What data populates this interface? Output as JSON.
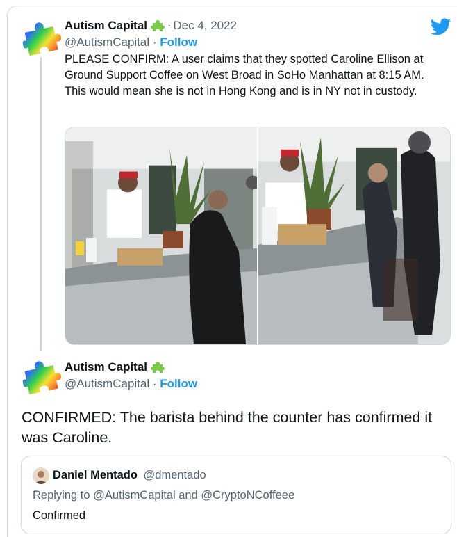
{
  "tweet1": {
    "author_name": "Autism Capital",
    "handle": "@AutismCapital",
    "separator": "·",
    "follow_label": "Follow",
    "date": "Dec 4, 2022",
    "text": "PLEASE CONFIRM: A user claims that they spotted Caroline Ellison at Ground Support Coffee on West Broad in SoHo Manhattan at 8:15 AM. This would mean she is not in Hong Kong and is in NY not in custody.",
    "avatar_icon": "rainbow-puzzle-piece-icon",
    "verified_icon": "green-puzzle-badge-icon",
    "photos": [
      "coffee-shop-counter-photo-left",
      "coffee-shop-counter-photo-right"
    ]
  },
  "tweet2": {
    "author_name": "Autism Capital",
    "handle": "@AutismCapital",
    "separator": "·",
    "follow_label": "Follow",
    "text": "CONFIRMED: The barista behind the counter has confirmed it was Caroline."
  },
  "quoted": {
    "author_name": "Daniel Mentado",
    "handle": "@dmentado",
    "reply_context": "Replying to @AutismCapital and @CryptoNCoffeee",
    "text": "Confirmed"
  },
  "brand": {
    "icon": "twitter-bird-icon",
    "accent": "#1d9bf0",
    "text_primary": "#0f1419",
    "text_secondary": "#536471",
    "border": "#cfd9de"
  }
}
